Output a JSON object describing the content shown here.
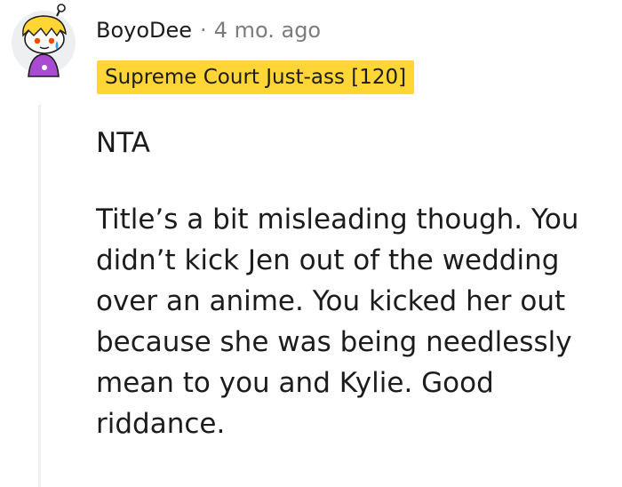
{
  "comment": {
    "author": "BoyoDee",
    "separator": "·",
    "timestamp": "4 mo. ago",
    "flair": "Supreme Court Just-ass [120]",
    "flair_color": "#ffd635",
    "avatar_icon": "snoo-avatar-icon",
    "paragraphs": [
      "NTA",
      "Title’s a bit misleading though. You didn’t kick Jen out of the wedding over an anime. You kicked her out because she was being needlessly mean to you and Kylie. Good riddance."
    ]
  }
}
